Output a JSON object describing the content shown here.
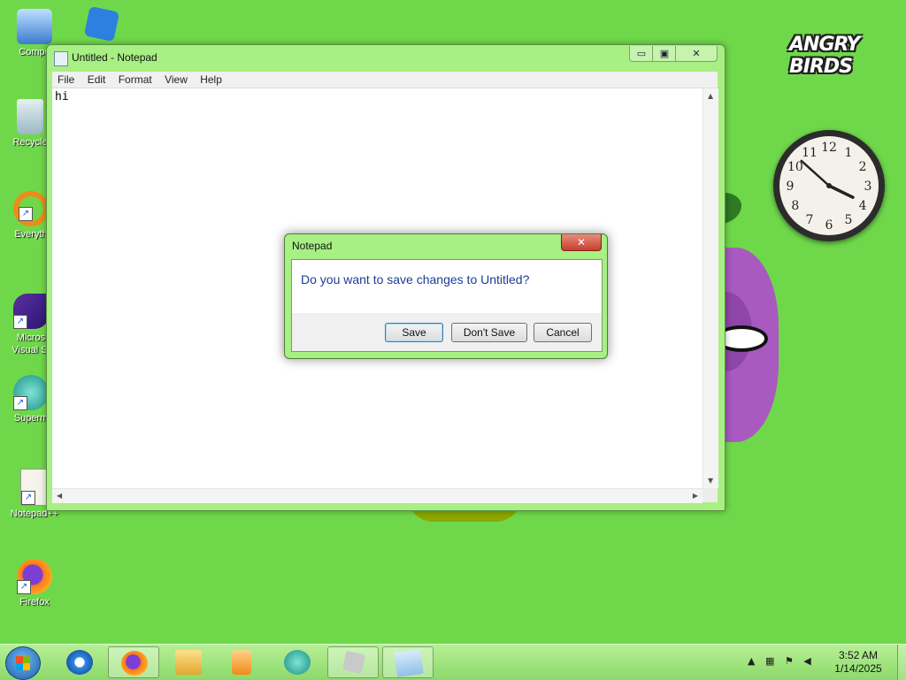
{
  "wallpaper": {
    "brand": "ANGRY BIRDS"
  },
  "desktop_icons": [
    {
      "label": "Compu",
      "icon": "computer-icon"
    },
    {
      "label": "Recycle",
      "icon": "recycle-bin-icon"
    },
    {
      "label": "Everyth",
      "icon": "everything-search-icon"
    },
    {
      "label": "Micros Visual St",
      "icon": "visual-studio-icon"
    },
    {
      "label": "Superm",
      "icon": "supermium-icon"
    },
    {
      "label": "Notepad++",
      "icon": "notepadpp-icon"
    },
    {
      "label": "Firefox",
      "icon": "firefox-icon"
    }
  ],
  "notepad": {
    "title": "Untitled - Notepad",
    "menu": [
      "File",
      "Edit",
      "Format",
      "View",
      "Help"
    ],
    "content": "hi",
    "controls": {
      "minimize": "▭",
      "maximize": "▣",
      "close": "✕"
    }
  },
  "dialog": {
    "title": "Notepad",
    "message": "Do you want to save changes to Untitled?",
    "buttons": {
      "save": "Save",
      "dont_save": "Don't Save",
      "cancel": "Cancel"
    },
    "close_glyph": "✕"
  },
  "clock_gadget": {
    "numbers": [
      "12",
      "1",
      "2",
      "3",
      "4",
      "5",
      "6",
      "7",
      "8",
      "9",
      "10",
      "11"
    ],
    "time": "3:52"
  },
  "taskbar": {
    "pinned": [
      "internet-explorer-icon",
      "firefox-icon",
      "file-explorer-icon",
      "media-player-icon",
      "supermium-icon",
      "roblox-icon",
      "notepad-icon"
    ],
    "tray_arrow": "▲",
    "time": "3:52 AM",
    "date": "1/14/2025"
  },
  "colors": {
    "desktop": "#6fd84a",
    "window_frame": "#a8ef84",
    "dialog_text": "#1c3d95"
  }
}
